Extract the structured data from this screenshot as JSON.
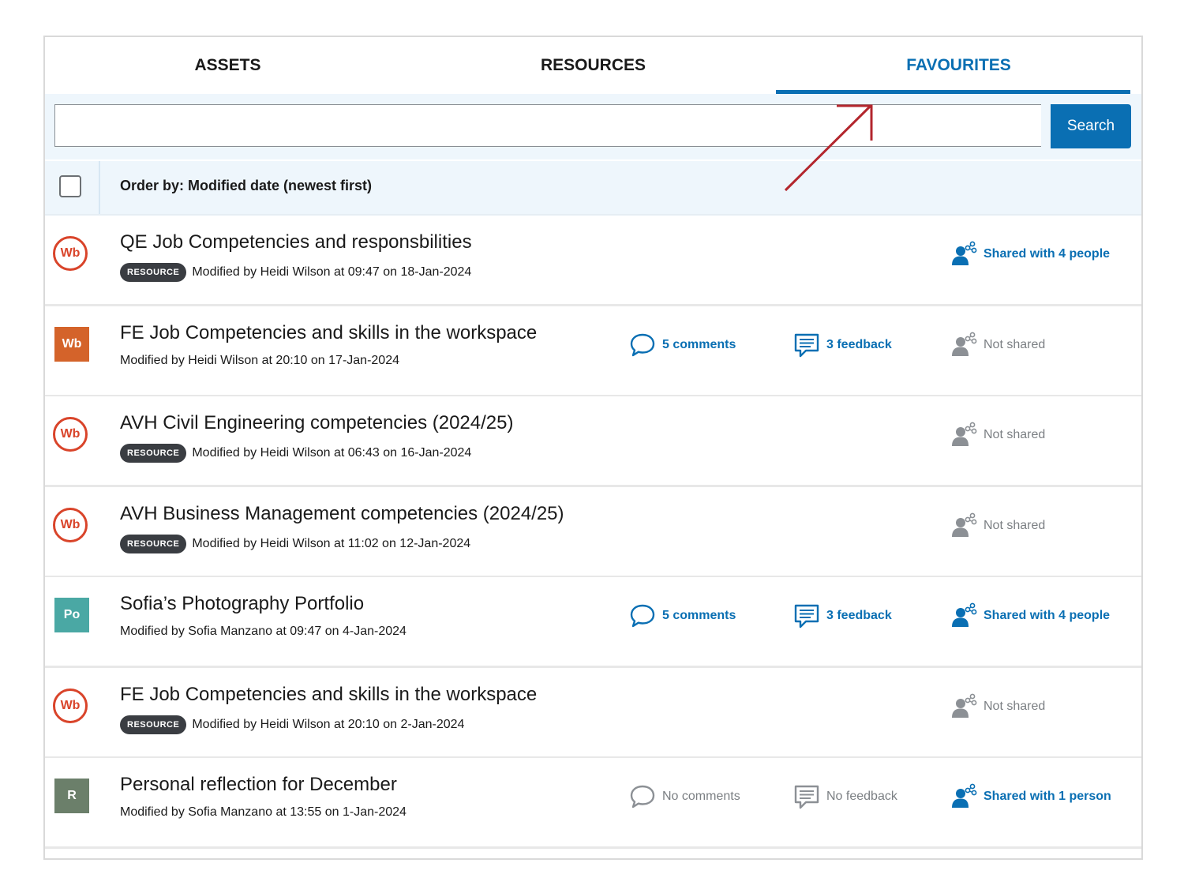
{
  "tabs": [
    {
      "label": "ASSETS",
      "active": false
    },
    {
      "label": "RESOURCES",
      "active": false
    },
    {
      "label": "FAVOURITES",
      "active": true
    }
  ],
  "search": {
    "placeholder": "",
    "value": "",
    "button_label": "Search"
  },
  "order": {
    "label": "Order by: Modified date (newest first)"
  },
  "colors": {
    "accent": "#0a6fb3",
    "wb_orange": "#d9442a",
    "wb_square": "#d4632a",
    "po_teal": "#4aa8a4",
    "r_green": "#6b7f6a",
    "badge": "#3a3d42",
    "muted": "#7b7f83"
  },
  "items": [
    {
      "thumb": "Wb",
      "thumb_style": "circle",
      "title": "QE Job Competencies and responsbilities",
      "badge": "RESOURCE",
      "meta": "Modified by Heidi Wilson at 09:47 on 18-Jan-2024",
      "comments": null,
      "feedback": null,
      "share": "Shared with 4 people",
      "shared": true
    },
    {
      "thumb": "Wb",
      "thumb_style": "square-orange",
      "title": "FE Job Competencies and skills in the workspace",
      "badge": null,
      "meta": "Modified by Heidi Wilson at 20:10 on 17-Jan-2024",
      "comments": "5 comments",
      "comments_active": true,
      "feedback": "3 feedback",
      "feedback_active": true,
      "share": "Not shared",
      "shared": false
    },
    {
      "thumb": "Wb",
      "thumb_style": "circle",
      "title": "AVH Civil Engineering competencies (2024/25)",
      "badge": "RESOURCE",
      "meta": "Modified by Heidi Wilson at 06:43 on 16-Jan-2024",
      "comments": null,
      "feedback": null,
      "share": "Not shared",
      "shared": false
    },
    {
      "thumb": "Wb",
      "thumb_style": "circle",
      "title": "AVH Business Management competencies (2024/25)",
      "badge": "RESOURCE",
      "meta": "Modified by Heidi Wilson at 11:02 on 12-Jan-2024",
      "comments": null,
      "feedback": null,
      "share": "Not shared",
      "shared": false
    },
    {
      "thumb": "Po",
      "thumb_style": "square-teal",
      "title": "Sofia’s Photography Portfolio",
      "badge": null,
      "meta": "Modified by Sofia Manzano at 09:47 on 4-Jan-2024",
      "comments": "5 comments",
      "comments_active": true,
      "feedback": "3 feedback",
      "feedback_active": true,
      "share": "Shared with 4 people",
      "shared": true
    },
    {
      "thumb": "Wb",
      "thumb_style": "circle",
      "title": "FE Job Competencies and skills in the workspace",
      "badge": "RESOURCE",
      "meta": "Modified by Heidi Wilson at 20:10 on 2-Jan-2024",
      "comments": null,
      "feedback": null,
      "share": "Not shared",
      "shared": false
    },
    {
      "thumb": "R",
      "thumb_style": "square-green",
      "title": "Personal reflection for December",
      "badge": null,
      "meta": "Modified by Sofia Manzano at 13:55 on 1-Jan-2024",
      "comments": "No comments",
      "comments_active": false,
      "feedback": "No feedback",
      "feedback_active": false,
      "share": "Shared with 1 person",
      "shared": true
    }
  ]
}
